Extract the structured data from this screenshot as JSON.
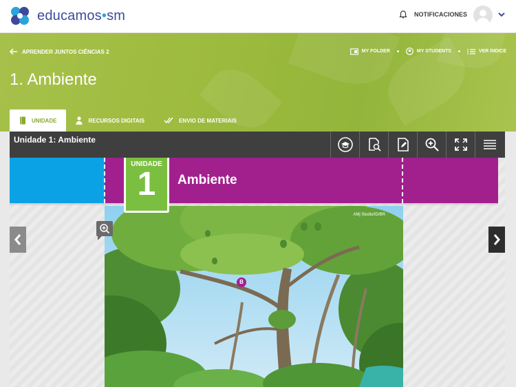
{
  "header": {
    "brand_name": "educamos",
    "brand_suffix": "sm",
    "notifications_label": "NOTIFICACIONES",
    "logo_icon": "four-circles-logo",
    "colors": {
      "brand_blue": "#3d4a9a",
      "brand_cyan": "#2ea3da"
    }
  },
  "hero": {
    "back_label": "APRENDER JUNTOS CIÊNCIAS 2",
    "title": "1. Ambiente",
    "tools": [
      {
        "label": "MY FOLDER",
        "icon": "folder-icon"
      },
      {
        "label": "MY STUDENTS",
        "icon": "students-icon"
      },
      {
        "label": "VER ÍNDICE",
        "icon": "list-icon"
      }
    ],
    "tabs": [
      {
        "label": "UNIDADE",
        "icon": "book-icon",
        "active": true
      },
      {
        "label": "RECURSOS DIGITAIS",
        "icon": "person-icon",
        "active": false
      },
      {
        "label": "ENVIO DE MATERIAIS",
        "icon": "double-check-icon",
        "active": false
      }
    ],
    "colors": {
      "accent_green": "#9dbb3e"
    }
  },
  "toolbar": {
    "title": "Unidade 1: Ambiente",
    "buttons": [
      {
        "name": "teacher-mode-button",
        "icon": "graduation-cap-icon"
      },
      {
        "name": "search-page-button",
        "icon": "page-search-icon"
      },
      {
        "name": "edit-page-button",
        "icon": "edit-page-icon"
      },
      {
        "name": "zoom-in-button",
        "icon": "zoom-in-icon"
      },
      {
        "name": "fullscreen-button",
        "icon": "fullscreen-icon"
      },
      {
        "name": "menu-button",
        "icon": "hamburger-icon"
      }
    ]
  },
  "book": {
    "unit_label": "UNIDADE",
    "unit_number": "1",
    "unit_name": "Ambiente",
    "image_credit": "AMj Studio/ID/BR",
    "marker_label": "B",
    "colors": {
      "band_blue": "#0aa2e5",
      "band_purple": "#a2208e",
      "unit_green": "#7bbf41"
    }
  }
}
